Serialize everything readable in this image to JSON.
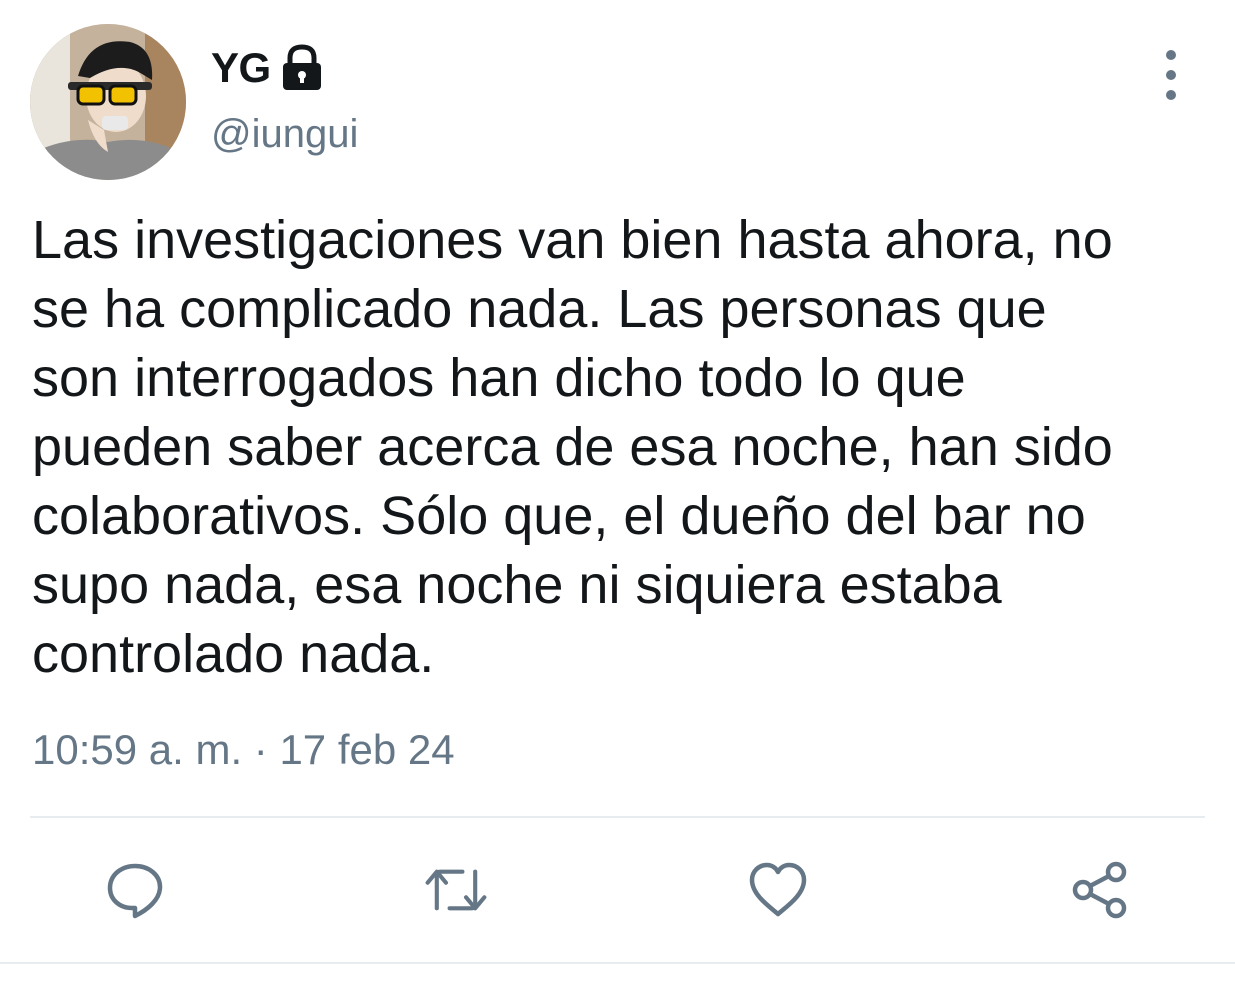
{
  "user": {
    "display_name": "YG",
    "handle": "@iungui",
    "protected": true
  },
  "tweet": {
    "text": "Las investigaciones van bien hasta ahora, no\nse ha complicado nada. Las personas que\nson interrogados han dicho todo lo que\npueden saber acerca de esa noche, han sido\ncolaborativos. Sólo que, el dueño del bar no\nsupo nada, esa noche ni siquiera estaba\ncontrolado nada.",
    "timestamp": "10:59 a. m. · 17 feb 24"
  },
  "actions": [
    {
      "icon": "reply-icon"
    },
    {
      "icon": "retweet-icon"
    },
    {
      "icon": "like-icon"
    },
    {
      "icon": "share-icon"
    }
  ],
  "colors": {
    "text_primary": "#14171a",
    "text_secondary": "#657786",
    "divider": "#e6ecf0"
  }
}
